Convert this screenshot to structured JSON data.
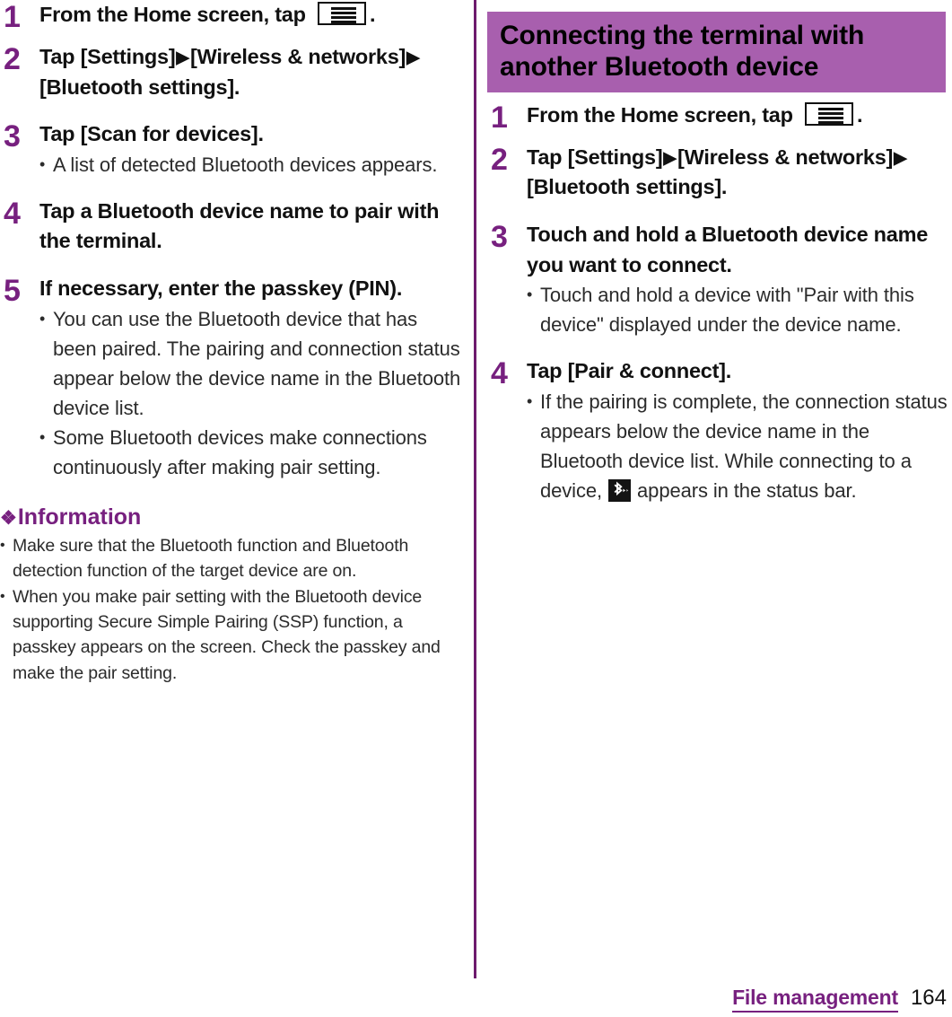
{
  "page": {
    "footer_section": "File management",
    "footer_page_number": "164",
    "colors": {
      "accent_purple": "#77207f",
      "band_mauve": "#a85fae",
      "divider_purple": "#6d1b6d"
    }
  },
  "left_column": {
    "steps": [
      {
        "number": "1",
        "title_before_icon": "From the Home screen, tap ",
        "icon": "menu-icon",
        "title_after_icon": ".",
        "bullets": []
      },
      {
        "number": "2",
        "title_parts": [
          "Tap [Settings]",
          "▶",
          "[Wireless & networks]",
          "▶",
          "[Bluetooth settings]."
        ],
        "bullets": []
      },
      {
        "number": "3",
        "title": "Tap [Scan for devices].",
        "bullets": [
          "A list of detected Bluetooth devices appears."
        ]
      },
      {
        "number": "4",
        "title": "Tap a Bluetooth device name to pair with the terminal.",
        "bullets": []
      },
      {
        "number": "5",
        "title": "If necessary, enter the passkey (PIN).",
        "bullets": [
          "You can use the Bluetooth device that has been paired. The pairing and connection status appear below the device name in the Bluetooth device list.",
          "Some Bluetooth devices make connections continuously after making pair setting."
        ]
      }
    ],
    "information": {
      "floret": "❖",
      "heading": "Information",
      "bullets": [
        "Make sure that the Bluetooth function and Bluetooth detection function of the target device are on.",
        "When you make pair setting with the Bluetooth device supporting Secure Simple Pairing (SSP) function, a passkey appears on the screen. Check the passkey and make the pair setting."
      ]
    }
  },
  "right_column": {
    "section_title": "Connecting the terminal with another Bluetooth device",
    "steps": [
      {
        "number": "1",
        "title_before_icon": "From the Home screen, tap ",
        "icon": "menu-icon",
        "title_after_icon": ".",
        "bullets": []
      },
      {
        "number": "2",
        "title_parts": [
          "Tap [Settings]",
          "▶",
          "[Wireless & networks]",
          "▶",
          "[Bluetooth settings]."
        ],
        "bullets": []
      },
      {
        "number": "3",
        "title": "Touch and hold a Bluetooth device name you want to connect.",
        "bullets": [
          "Touch and hold a device with \"Pair with this device\" displayed under the device name."
        ]
      },
      {
        "number": "4",
        "title": "Tap [Pair & connect].",
        "bullet_before_icon": "If the pairing is complete, the connection status appears below the device name in the Bluetooth device list. While connecting to a device, ",
        "bullet_icon": "bluetooth-connecting-icon",
        "bullet_after_icon": " appears in the status bar."
      }
    ]
  }
}
